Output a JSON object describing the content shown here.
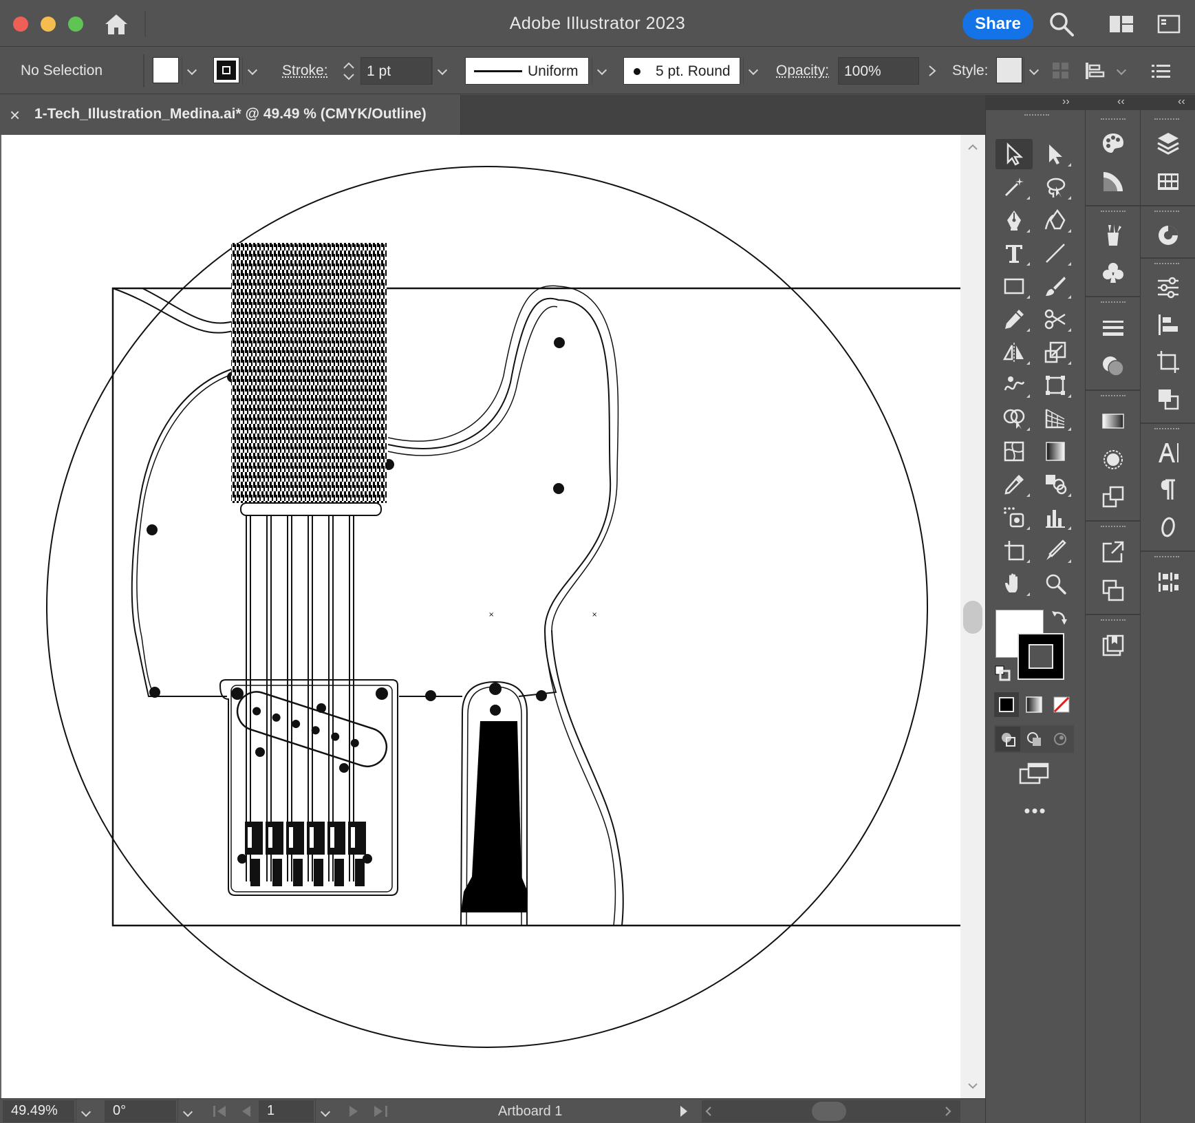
{
  "window": {
    "title": "Adobe Illustrator 2023",
    "share_label": "Share"
  },
  "control": {
    "selection": "No Selection",
    "stroke_label": "Stroke:",
    "stroke_weight": "1 pt",
    "profile": "Uniform",
    "brush": "5 pt. Round",
    "opacity_label": "Opacity:",
    "opacity": "100%",
    "style_label": "Style:"
  },
  "document": {
    "tab_title": "1-Tech_Illustration_Medina.ai* @ 49.49 % (CMYK/Outline)",
    "close_glyph": "×"
  },
  "status": {
    "zoom": "49.49%",
    "rotation": "0°",
    "artboard_number": "1",
    "artboard_name": "Artboard 1"
  },
  "colors": {
    "chrome": "#535353",
    "accent": "#1473e6",
    "canvas": "#ffffff"
  },
  "tools": [
    "selection-tool",
    "direct-selection-tool",
    "magic-wand-tool",
    "lasso-tool",
    "pen-tool",
    "curvature-tool",
    "type-tool",
    "line-segment-tool",
    "rectangle-tool",
    "paintbrush-tool",
    "pencil-tool",
    "scissors-tool",
    "reflect-tool",
    "scale-tool",
    "warp-tool",
    "free-transform-tool",
    "shape-builder-tool",
    "perspective-grid-tool",
    "mesh-tool",
    "gradient-tool",
    "eyedropper-tool",
    "blend-tool",
    "symbol-sprayer-tool",
    "column-graph-tool",
    "artboard-tool",
    "slice-tool",
    "hand-tool",
    "zoom-tool"
  ]
}
